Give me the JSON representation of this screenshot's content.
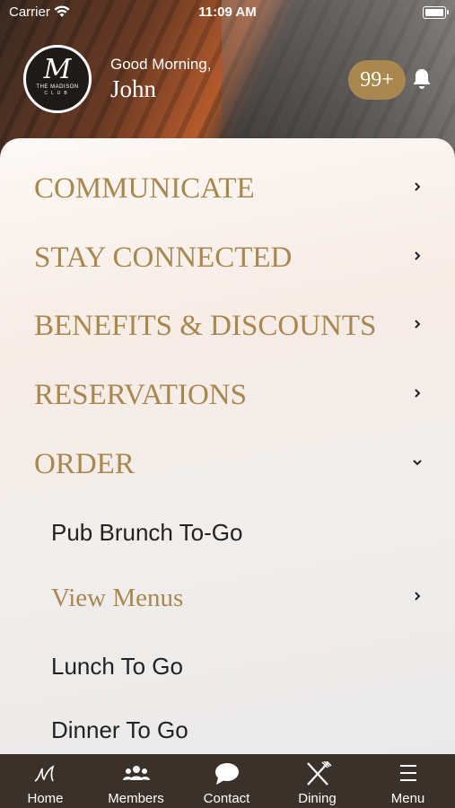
{
  "status_bar": {
    "carrier": "Carrier",
    "time": "11:09 AM"
  },
  "header": {
    "logo": {
      "monogram": "M",
      "name": "THE MADISON",
      "club": "CLUB"
    },
    "greeting": "Good Morning,",
    "username": "John",
    "notification_badge": "99+"
  },
  "menu": {
    "items": [
      {
        "label": "COMMUNICATE",
        "chevron": "chevron-right-icon"
      },
      {
        "label": "STAY CONNECTED",
        "chevron": "chevron-right-icon"
      },
      {
        "label": "BENEFITS & DISCOUNTS",
        "chevron": "chevron-right-icon"
      },
      {
        "label": "RESERVATIONS",
        "chevron": "chevron-right-icon"
      },
      {
        "label": "ORDER",
        "chevron": "chevron-down-icon"
      }
    ],
    "sub_items": [
      {
        "label": "Pub Brunch To-Go"
      },
      {
        "label": "View Menus"
      },
      {
        "label": "Lunch To Go"
      },
      {
        "label": "Dinner To Go"
      }
    ]
  },
  "tabbar": {
    "tabs": [
      {
        "label": "Home",
        "icon": "monogram-icon"
      },
      {
        "label": "Members",
        "icon": "members-icon"
      },
      {
        "label": "Contact",
        "icon": "chat-bubble-icon"
      },
      {
        "label": "Dining",
        "icon": "fork-knife-icon"
      },
      {
        "label": "Menu",
        "icon": "hamburger-icon"
      }
    ]
  },
  "colors": {
    "accent_gold": "#a9884f",
    "tabbar_bg": "#3b312b",
    "text_dark": "#222222"
  }
}
